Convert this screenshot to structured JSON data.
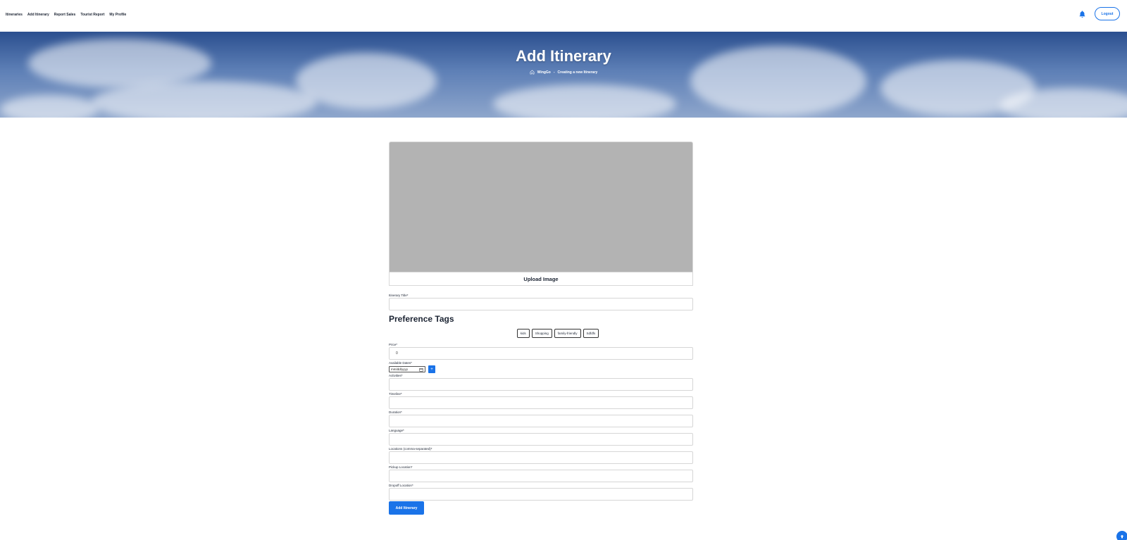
{
  "nav": {
    "items": [
      "Itineraries",
      "Add Itinerary",
      "Report Sales",
      "Tourist Report",
      "My Profile"
    ],
    "logout_label": "Logout"
  },
  "hero": {
    "title": "Add Itinerary",
    "breadcrumb_home": "WingGo",
    "breadcrumb_separator": "-",
    "breadcrumb_current": "Creating a new Itinerary"
  },
  "form": {
    "upload_label": "Upload Image",
    "title_label": "Itinerary Title*",
    "title_value": "",
    "preference_heading": "Preference Tags",
    "tags": [
      "kids",
      "Shopping",
      "family-friendly",
      "Sdfdfs"
    ],
    "price_label": "Price*",
    "price_value": "0",
    "dates_label": "Available Dates*",
    "date_placeholder": "mm/dd/yyyy",
    "add_date_label": "+",
    "activities_label": "Activities*",
    "timeline_label": "Timeline*",
    "duration_label": "Duration*",
    "language_label": "Language*",
    "locations_label": "Locations (comma-separated)*",
    "pickup_label": "Pickup Location*",
    "dropoff_label": "Dropoff Location*",
    "submit_label": "Add Itinerary"
  },
  "colors": {
    "accent": "#1a73e8",
    "image_placeholder": "#b3b3b3"
  },
  "icons": [
    "bell-icon",
    "home-icon",
    "calendar-icon",
    "arrow-up-icon"
  ]
}
